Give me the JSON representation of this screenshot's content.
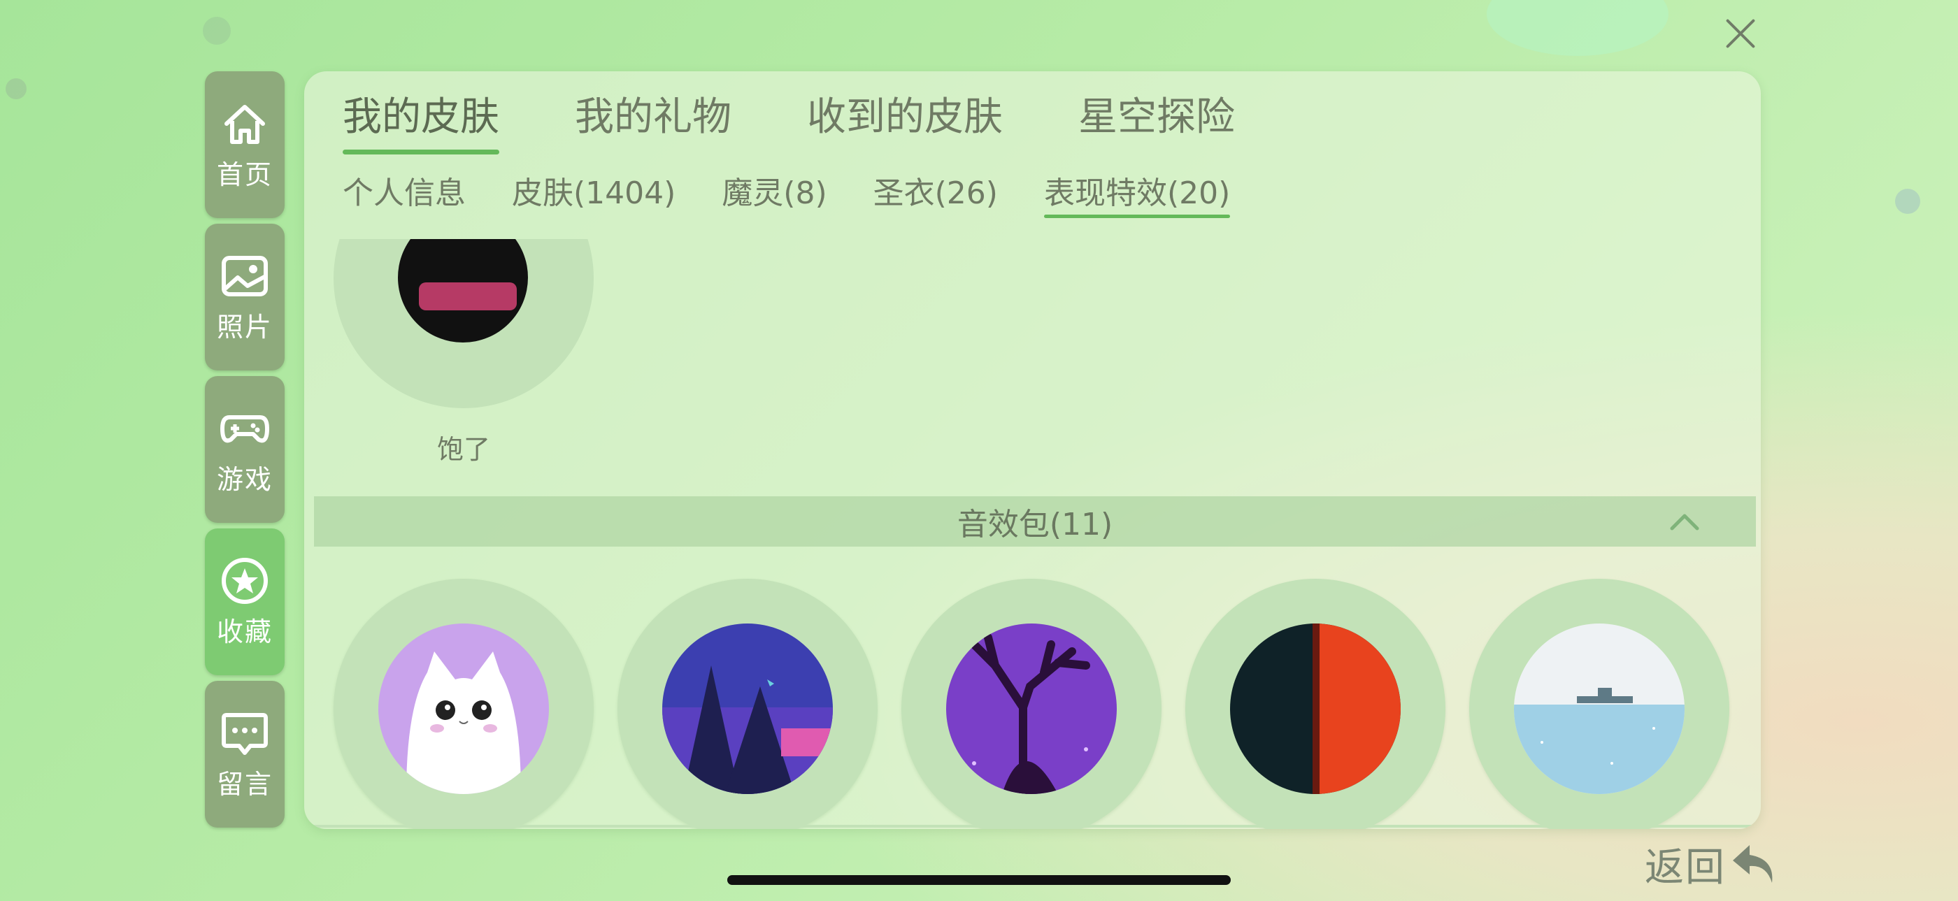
{
  "window": {
    "close_icon": "close-icon"
  },
  "sidebar": {
    "items": [
      {
        "label": "首页",
        "icon": "home-icon",
        "active": false
      },
      {
        "label": "照片",
        "icon": "photo-icon",
        "active": false
      },
      {
        "label": "游戏",
        "icon": "gamepad-icon",
        "active": false
      },
      {
        "label": "收藏",
        "icon": "star-icon",
        "active": true
      },
      {
        "label": "留言",
        "icon": "message-icon",
        "active": false
      }
    ]
  },
  "main": {
    "tabs": [
      "我的皮肤",
      "我的礼物",
      "收到的皮肤",
      "星空探险"
    ],
    "active_tab": "我的皮肤",
    "subtabs": [
      "个人信息",
      "皮肤(1404)",
      "魔灵(8)",
      "圣衣(26)",
      "表现特效(20)"
    ],
    "active_subtab": "表现特效(20)",
    "top_item_label": "饱了",
    "section": {
      "title": "音效包(11)",
      "toggle_icon": "chevron-up-icon"
    },
    "sound_packs": [
      "cat",
      "forest",
      "deer",
      "split-red-dark",
      "sea-ship"
    ]
  },
  "footer": {
    "back_label": "返回",
    "back_icon": "return-arrow-icon"
  },
  "colors": {
    "accent": "#64b95a",
    "sidebar": "#8eaa7c",
    "sidebar_active": "#7ecb72"
  }
}
